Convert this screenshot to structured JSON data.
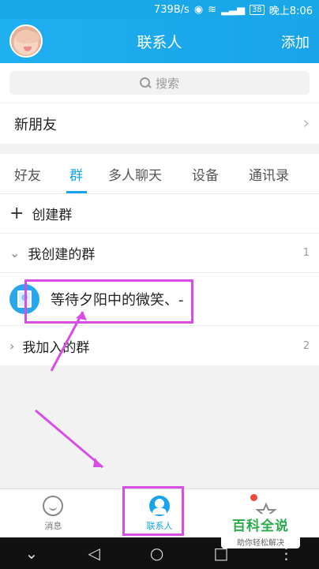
{
  "statusbar": {
    "speed": "739B/s",
    "battery": "38",
    "time": "晚上8:06",
    "icons": [
      "eye-icon",
      "wifi-icon",
      "signal-icon",
      "battery-icon"
    ]
  },
  "header": {
    "title": "联系人",
    "add_label": "添加"
  },
  "search": {
    "placeholder": "搜索"
  },
  "new_friends": {
    "label": "新朋友"
  },
  "tabs": [
    {
      "label": "好友",
      "active": false
    },
    {
      "label": "群",
      "active": true
    },
    {
      "label": "多人聊天",
      "active": false
    },
    {
      "label": "设备",
      "active": false
    },
    {
      "label": "通讯录",
      "active": false
    }
  ],
  "list": {
    "create_group": "创建群",
    "my_created": {
      "label": "我创建的群",
      "count": "1"
    },
    "group_item": {
      "name": "等待夕阳中的微笑、-"
    },
    "my_joined": {
      "label": "我加入的群",
      "count": "2"
    }
  },
  "bottom_nav": [
    {
      "label": "消息",
      "icon": "message-icon",
      "active": false
    },
    {
      "label": "联系人",
      "icon": "contacts-icon",
      "active": true
    },
    {
      "label": "",
      "icon": "star-icon",
      "active": false
    }
  ],
  "watermark": {
    "title": "百科全说",
    "subtitle": "助你轻松解决"
  },
  "colors": {
    "accent": "#17a4ea",
    "highlight": "#d84ee5",
    "badge": "#ef4b3b"
  }
}
